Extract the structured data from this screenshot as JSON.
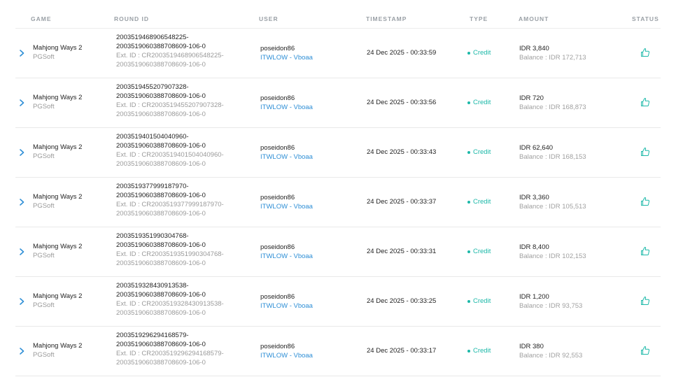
{
  "columns": {
    "game": "GAME",
    "round_id": "ROUND ID",
    "user": "USER",
    "timestamp": "TIMESTAMP",
    "type": "TYPE",
    "amount": "AMOUNT",
    "status": "STATUS"
  },
  "colors": {
    "accent": "#1bb8a8",
    "link": "#2f8fd6",
    "muted": "#9a9a9a"
  },
  "rows": [
    {
      "game": "Mahjong Ways 2",
      "provider": "PGSoft",
      "round_line1": "2003519468906548225-",
      "round_line2": "2003519060388708609-106-0",
      "ext_line1": "Ext. ID : CR2003519468906548225-",
      "ext_line2": "2003519060388708609-106-0",
      "user": "poseidon86",
      "user_link": "ITWLOW - Vboaa",
      "timestamp": "24 Dec 2025 - 00:33:59",
      "type": "Credit",
      "amount": "IDR 3,840",
      "balance": "Balance : IDR 172,713",
      "status_icon": "thumbs-up-icon"
    },
    {
      "game": "Mahjong Ways 2",
      "provider": "PGSoft",
      "round_line1": "2003519455207907328-",
      "round_line2": "2003519060388708609-106-0",
      "ext_line1": "Ext. ID : CR2003519455207907328-",
      "ext_line2": "2003519060388708609-106-0",
      "user": "poseidon86",
      "user_link": "ITWLOW - Vboaa",
      "timestamp": "24 Dec 2025 - 00:33:56",
      "type": "Credit",
      "amount": "IDR 720",
      "balance": "Balance : IDR 168,873",
      "status_icon": "thumbs-up-icon"
    },
    {
      "game": "Mahjong Ways 2",
      "provider": "PGSoft",
      "round_line1": "2003519401504040960-",
      "round_line2": "2003519060388708609-106-0",
      "ext_line1": "Ext. ID : CR2003519401504040960-",
      "ext_line2": "2003519060388708609-106-0",
      "user": "poseidon86",
      "user_link": "ITWLOW - Vboaa",
      "timestamp": "24 Dec 2025 - 00:33:43",
      "type": "Credit",
      "amount": "IDR 62,640",
      "balance": "Balance : IDR 168,153",
      "status_icon": "thumbs-up-icon"
    },
    {
      "game": "Mahjong Ways 2",
      "provider": "PGSoft",
      "round_line1": "2003519377999187970-",
      "round_line2": "2003519060388708609-106-0",
      "ext_line1": "Ext. ID : CR2003519377999187970-",
      "ext_line2": "2003519060388708609-106-0",
      "user": "poseidon86",
      "user_link": "ITWLOW - Vboaa",
      "timestamp": "24 Dec 2025 - 00:33:37",
      "type": "Credit",
      "amount": "IDR 3,360",
      "balance": "Balance : IDR 105,513",
      "status_icon": "thumbs-up-icon"
    },
    {
      "game": "Mahjong Ways 2",
      "provider": "PGSoft",
      "round_line1": "2003519351990304768-",
      "round_line2": "2003519060388708609-106-0",
      "ext_line1": "Ext. ID : CR2003519351990304768-",
      "ext_line2": "2003519060388708609-106-0",
      "user": "poseidon86",
      "user_link": "ITWLOW - Vboaa",
      "timestamp": "24 Dec 2025 - 00:33:31",
      "type": "Credit",
      "amount": "IDR 8,400",
      "balance": "Balance : IDR 102,153",
      "status_icon": "thumbs-up-icon"
    },
    {
      "game": "Mahjong Ways 2",
      "provider": "PGSoft",
      "round_line1": "2003519328430913538-",
      "round_line2": "2003519060388708609-106-0",
      "ext_line1": "Ext. ID : CR2003519328430913538-",
      "ext_line2": "2003519060388708609-106-0",
      "user": "poseidon86",
      "user_link": "ITWLOW - Vboaa",
      "timestamp": "24 Dec 2025 - 00:33:25",
      "type": "Credit",
      "amount": "IDR 1,200",
      "balance": "Balance : IDR 93,753",
      "status_icon": "thumbs-up-icon"
    },
    {
      "game": "Mahjong Ways 2",
      "provider": "PGSoft",
      "round_line1": "2003519296294168579-",
      "round_line2": "2003519060388708609-106-0",
      "ext_line1": "Ext. ID : CR2003519296294168579-",
      "ext_line2": "2003519060388708609-106-0",
      "user": "poseidon86",
      "user_link": "ITWLOW - Vboaa",
      "timestamp": "24 Dec 2025 - 00:33:17",
      "type": "Credit",
      "amount": "IDR 380",
      "balance": "Balance : IDR 92,553",
      "status_icon": "thumbs-up-icon"
    }
  ]
}
